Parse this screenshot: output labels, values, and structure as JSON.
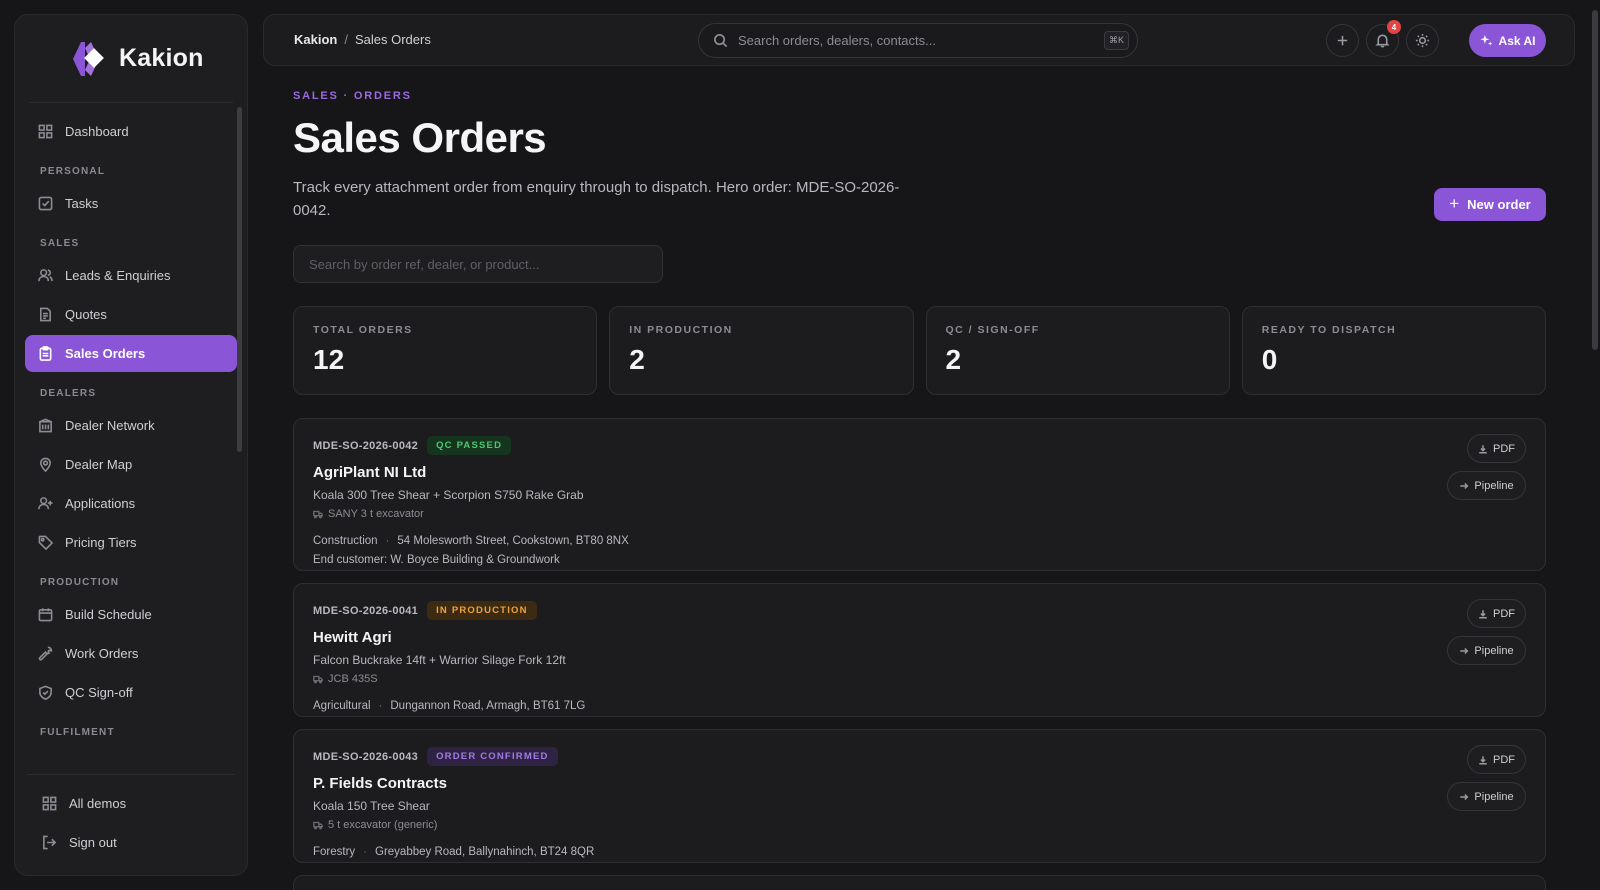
{
  "app": {
    "name": "Kakion"
  },
  "breadcrumb": {
    "root": "Kakion",
    "separator": "/",
    "current": "Sales Orders"
  },
  "search": {
    "placeholder": "Search orders, dealers, contacts...",
    "shortcut": "⌘K"
  },
  "header": {
    "notification_count": "4",
    "ask_ai_label": "Ask AI"
  },
  "sidebar": {
    "dashboard": "Dashboard",
    "sections": {
      "personal": "PERSONAL",
      "sales": "SALES",
      "dealers": "DEALERS",
      "production": "PRODUCTION",
      "fulfilment": "FULFILMENT"
    },
    "items": {
      "tasks": "Tasks",
      "leads": "Leads & Enquiries",
      "quotes": "Quotes",
      "sales_orders": "Sales Orders",
      "dealer_network": "Dealer Network",
      "dealer_map": "Dealer Map",
      "applications": "Applications",
      "pricing_tiers": "Pricing Tiers",
      "build_schedule": "Build Schedule",
      "work_orders": "Work Orders",
      "qc_signoff": "QC Sign-off"
    },
    "footer": {
      "all_demos": "All demos",
      "sign_out": "Sign out"
    }
  },
  "page": {
    "eyebrow": "SALES · ORDERS",
    "title": "Sales Orders",
    "subtitle": "Track every attachment order from enquiry through to dispatch. Hero order: MDE-SO-2026-0042.",
    "new_order_label": "New order",
    "filter_placeholder": "Search by order ref, dealer, or product..."
  },
  "stats": [
    {
      "label": "TOTAL ORDERS",
      "value": "12"
    },
    {
      "label": "IN PRODUCTION",
      "value": "2"
    },
    {
      "label": "QC / SIGN-OFF",
      "value": "2"
    },
    {
      "label": "READY TO DISPATCH",
      "value": "0"
    }
  ],
  "order_actions": {
    "pdf": "PDF",
    "pipeline": "Pipeline"
  },
  "orders": [
    {
      "ref": "MDE-SO-2026-0042",
      "status": "QC PASSED",
      "dealer": "AgriPlant NI Ltd",
      "product": "Koala 300 Tree Shear + Scorpion S750 Rake Grab",
      "machine": "SANY 3 t excavator",
      "sector": "Construction",
      "address": "54 Molesworth Street, Cookstown, BT80 8NX",
      "end_customer": "End customer: W. Boyce Building & Groundwork"
    },
    {
      "ref": "MDE-SO-2026-0041",
      "status": "IN PRODUCTION",
      "dealer": "Hewitt Agri",
      "product": "Falcon Buckrake 14ft + Warrior Silage Fork 12ft",
      "machine": "JCB 435S",
      "sector": "Agricultural",
      "address": "Dungannon Road, Armagh, BT61 7LG"
    },
    {
      "ref": "MDE-SO-2026-0043",
      "status": "ORDER CONFIRMED",
      "dealer": "P. Fields Contracts",
      "product": "Koala 150 Tree Shear",
      "machine": "5 t excavator (generic)",
      "sector": "Forestry",
      "address": "Greyabbey Road, Ballynahinch, BT24 8QR"
    }
  ],
  "colors": {
    "accent": "#8a55d6",
    "background": "#161618",
    "qc_passed": "#4ec872",
    "in_production": "#f0a23a",
    "confirmed": "#a37ae6"
  }
}
